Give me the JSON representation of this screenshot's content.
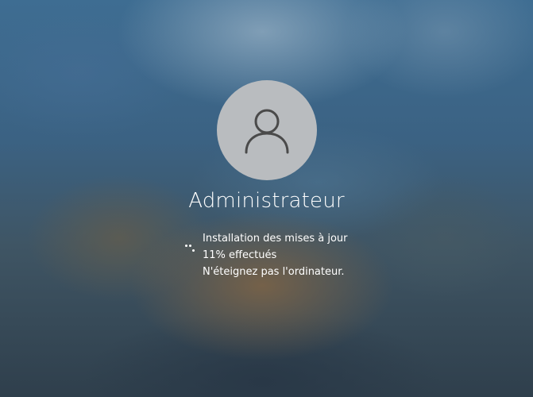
{
  "lockscreen": {
    "user_name": "Administrateur",
    "avatar_icon": "person-icon",
    "avatar_color": "#b9bcbf"
  },
  "update_status": {
    "spinner_icon": "loading-spinner-icon",
    "line1": "Installation des mises à jour",
    "line2": "11% effectués",
    "line3": "N'éteignez pas l'ordinateur.",
    "progress_percent": 11
  }
}
